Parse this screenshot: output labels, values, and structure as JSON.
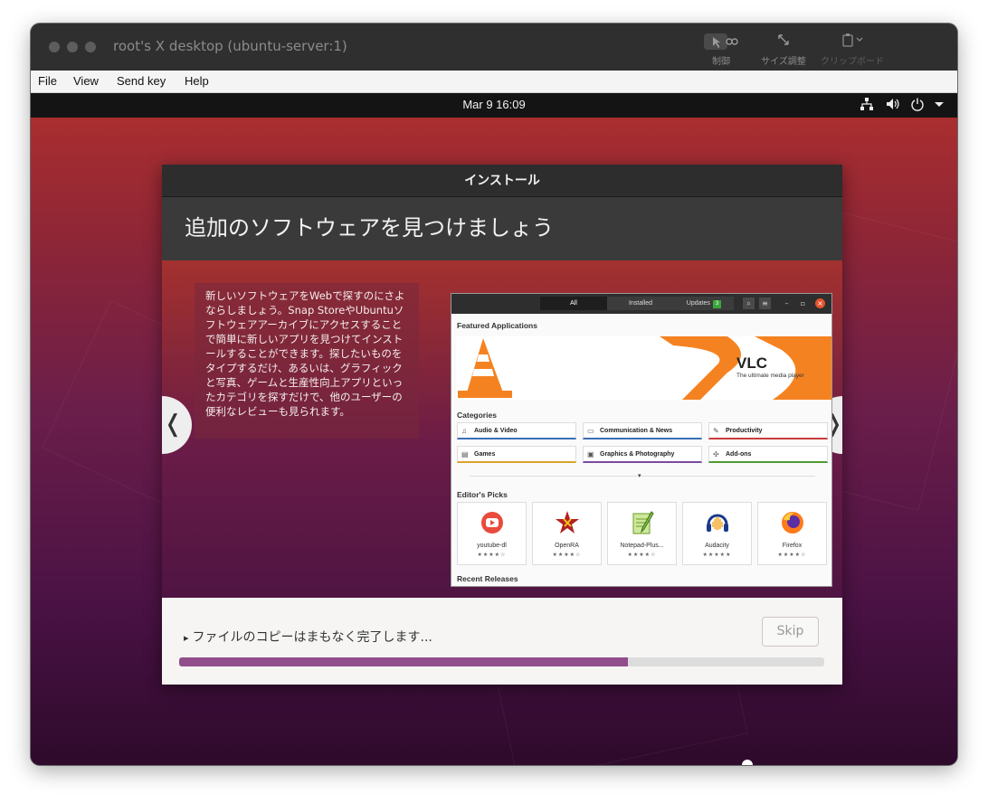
{
  "window": {
    "title": "root's X desktop (ubuntu-server:1)",
    "toolbar": [
      {
        "label": "制御",
        "icon": "control-icon"
      },
      {
        "label": "サイズ調整",
        "icon": "resize-icon"
      },
      {
        "label": "クリップボード",
        "icon": "clipboard-icon"
      }
    ]
  },
  "menubar": {
    "items": [
      {
        "label": "File"
      },
      {
        "label": "View"
      },
      {
        "label": "Send key"
      },
      {
        "label": "Help"
      }
    ]
  },
  "topbar": {
    "clock": "Mar 9  16:09",
    "icons": [
      "network-icon",
      "volume-icon",
      "power-icon",
      "chevron-down-icon"
    ]
  },
  "installer": {
    "header_title": "インストール",
    "banner_title": "追加のソフトウェアを見つけましょう",
    "slide_text": "新しいソフトウェアをWebで探すのにさよならしましょう。Snap StoreやUbuntuソフトウェアアーカイブにアクセスすることで簡単に新しいアプリを見つけてインストールすることができます。探したいものをタイプするだけ、あるいは、グラフィックと写真、ゲームと生産性向上アプリといったカテゴリを探すだけで、他のユーザーの便利なレビューも見られます。",
    "nav_prev": "❬",
    "nav_next": "❭",
    "status_text": "ファイルのコピーはまもなく完了します...",
    "status_arrow": "▸",
    "skip_label": "Skip",
    "progress": 0.695
  },
  "software_preview": {
    "tabs": [
      {
        "label": "All"
      },
      {
        "label": "Installed"
      },
      {
        "label": "Updates",
        "badge": "3"
      }
    ],
    "featured_heading": "Featured Applications",
    "featured_title": "VLC",
    "featured_subtitle": "The ultimate media player",
    "categories_heading": "Categories",
    "categories": [
      {
        "label": "Audio & Video",
        "icon": "music-note-icon",
        "color": "#3a6fb5"
      },
      {
        "label": "Communication & News",
        "icon": "chat-icon",
        "color": "#3a6fb5"
      },
      {
        "label": "Productivity",
        "icon": "edit-icon",
        "color": "#c93c3c"
      },
      {
        "label": "Games",
        "icon": "games-icon",
        "color": "#d9a42a"
      },
      {
        "label": "Graphics & Photography",
        "icon": "image-icon",
        "color": "#7a4aa0"
      },
      {
        "label": "Add-ons",
        "icon": "puzzle-icon",
        "color": "#4f9a34"
      }
    ],
    "picks_heading": "Editor's Picks",
    "picks": [
      {
        "name": "youtube-dl",
        "stars": "★★★★☆",
        "icon": "youtube-dl-icon"
      },
      {
        "name": "OpenRA",
        "stars": "★★★★☆",
        "icon": "openra-icon"
      },
      {
        "name": "Notepad-Plus...",
        "stars": "★★★★☆",
        "icon": "notepad-plus-icon"
      },
      {
        "name": "Audacity",
        "stars": "★★★★★",
        "icon": "audacity-icon"
      },
      {
        "name": "Firefox",
        "stars": "★★★★☆",
        "icon": "firefox-icon"
      }
    ],
    "recent_heading": "Recent Releases"
  }
}
